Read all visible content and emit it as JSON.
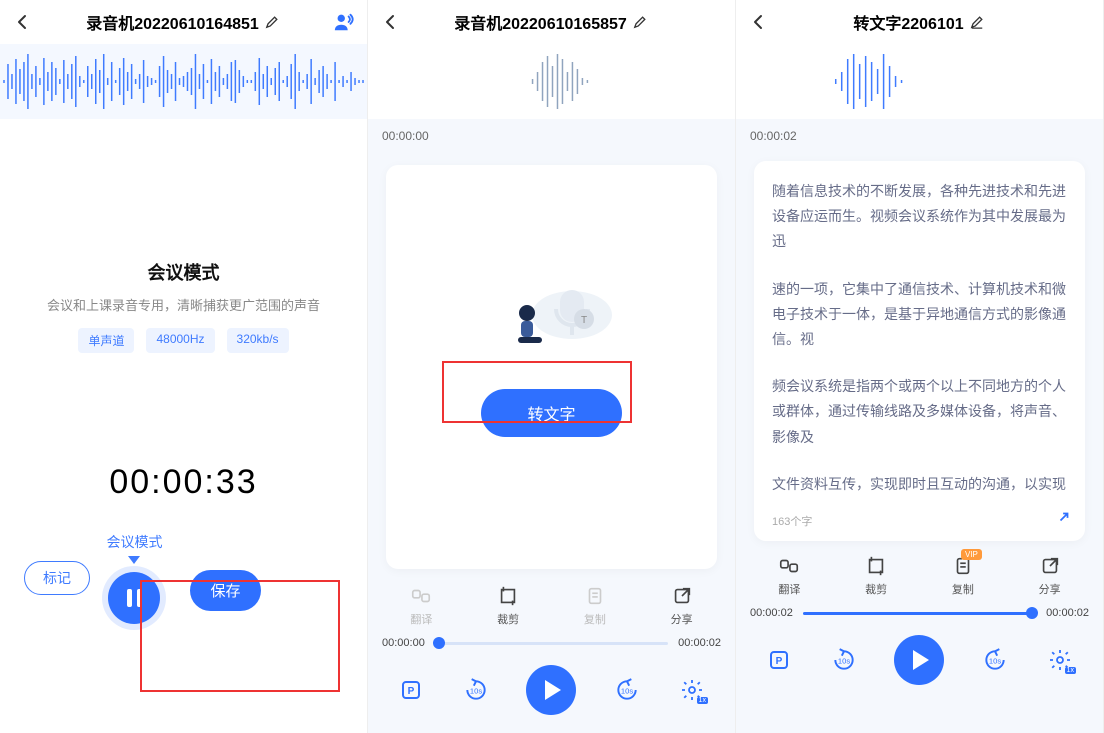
{
  "pane1": {
    "title": "录音机20220610164851",
    "modeTitle": "会议模式",
    "modeSub": "会议和上课录音专用，清晰捕获更广范围的声音",
    "chips": [
      "单声道",
      "48000Hz",
      "320kb/s"
    ],
    "timer": "00:00:33",
    "markBtn": "标记",
    "modeLabel": "会议模式",
    "saveBtn": "保存"
  },
  "pane2": {
    "title": "录音机20220610165857",
    "timeStart": "00:00:00",
    "convertBtn": "转文字",
    "actions": {
      "translate": "翻译",
      "crop": "裁剪",
      "copy": "复制",
      "share": "分享"
    },
    "progStart": "00:00:00",
    "progEnd": "00:00:02"
  },
  "pane3": {
    "title": "转文字2206101",
    "timeStart": "00:00:02",
    "paragraphs": [
      "随着信息技术的不断发展，各种先进技术和先进设备应运而生。视频会议系统作为其中发展最为迅",
      "速的一项，它集中了通信技术、计算机技术和微电子技术于一体，是基于异地通信方式的影像通信。视",
      "频会议系统是指两个或两个以上不同地方的个人或群体，通过传输线路及多媒体设备，将声音、影像及",
      "文件资料互传，实现即时且互动的沟通，以实现"
    ],
    "wordCount": "163个字",
    "actions": {
      "translate": "翻译",
      "crop": "裁剪",
      "copy": "复制",
      "share": "分享",
      "vip": "VIP"
    },
    "progStart": "00:00:02",
    "progEnd": "00:00:02"
  }
}
